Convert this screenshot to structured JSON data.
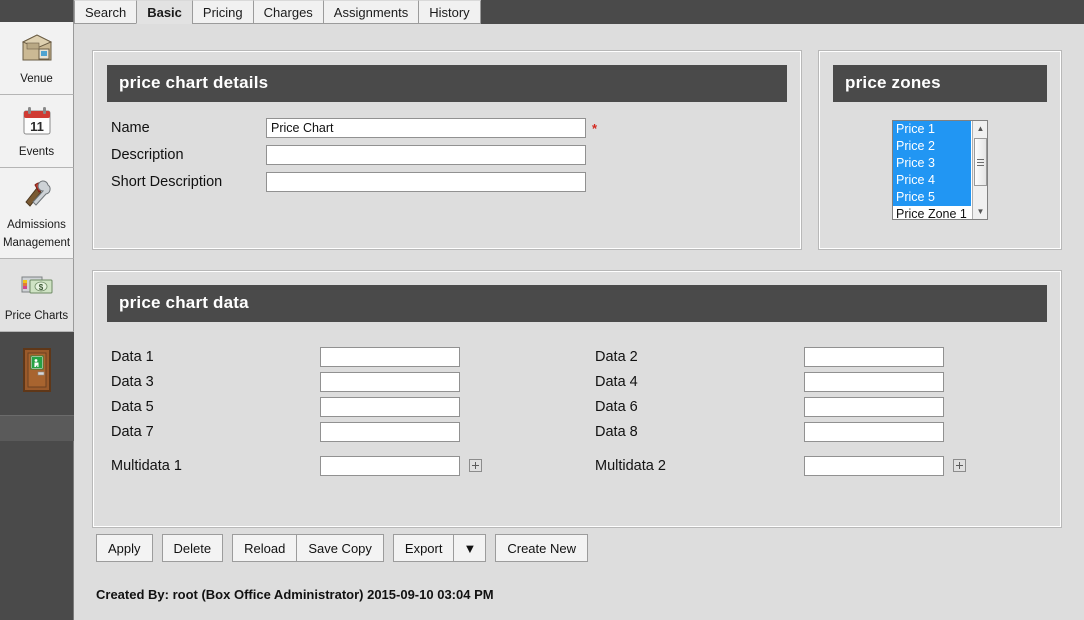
{
  "sidebar": {
    "items": [
      {
        "label": "Venue",
        "icon": "venue-icon",
        "selected": false
      },
      {
        "label": "Events",
        "icon": "calendar-icon",
        "selected": false
      },
      {
        "label": "Admissions Management",
        "icon": "tools-icon",
        "selected": false
      },
      {
        "label": "Price Charts",
        "icon": "money-icon",
        "selected": true
      }
    ],
    "exit_icon": "exit-door-icon"
  },
  "tabs": [
    {
      "label": "Search",
      "active": false
    },
    {
      "label": "Basic",
      "active": true
    },
    {
      "label": "Pricing",
      "active": false
    },
    {
      "label": "Charges",
      "active": false
    },
    {
      "label": "Assignments",
      "active": false
    },
    {
      "label": "History",
      "active": false
    }
  ],
  "details": {
    "title": "price chart details",
    "fields": [
      {
        "label": "Name",
        "value": "Price Chart",
        "placeholder": "",
        "required": true
      },
      {
        "label": "Description",
        "value": "",
        "placeholder": "",
        "required": false
      },
      {
        "label": "Short Description",
        "value": "",
        "placeholder": "",
        "required": false
      }
    ],
    "required_marker": "*"
  },
  "zones": {
    "title": "price zones",
    "options": [
      {
        "label": "Price 1",
        "selected": true
      },
      {
        "label": "Price 2",
        "selected": true
      },
      {
        "label": "Price 3",
        "selected": true
      },
      {
        "label": "Price 4",
        "selected": true
      },
      {
        "label": "Price 5",
        "selected": true
      },
      {
        "label": "Price Zone 1",
        "selected": false
      }
    ],
    "scroll_up": "▲",
    "scroll_down": "▼"
  },
  "chart_data_section": {
    "title": "price chart data",
    "left_column": [
      {
        "label": "Data 1",
        "value": "",
        "multi": false
      },
      {
        "label": "Data 3",
        "value": "",
        "multi": false
      },
      {
        "label": "Data 5",
        "value": "",
        "multi": false
      },
      {
        "label": "Data 7",
        "value": "",
        "multi": false
      },
      {
        "label": "Multidata 1",
        "value": "",
        "multi": true
      }
    ],
    "right_column": [
      {
        "label": "Data 2",
        "value": "",
        "multi": false
      },
      {
        "label": "Data 4",
        "value": "",
        "multi": false
      },
      {
        "label": "Data 6",
        "value": "",
        "multi": false
      },
      {
        "label": "Data 8",
        "value": "",
        "multi": false
      },
      {
        "label": "Multidata 2",
        "value": "",
        "multi": true
      }
    ]
  },
  "buttons": {
    "apply": "Apply",
    "delete": "Delete",
    "reload": "Reload",
    "save_copy": "Save Copy",
    "export": "Export",
    "export_arrow": "▼",
    "create_new": "Create New"
  },
  "footer": {
    "text": "Created By: root (Box Office Administrator) 2015-09-10 03:04 PM"
  },
  "colors": {
    "header_bar": "#4a4a4a",
    "panel_bg": "#dddddd",
    "selection_blue": "#2196f3",
    "required_red": "#d4281f"
  }
}
